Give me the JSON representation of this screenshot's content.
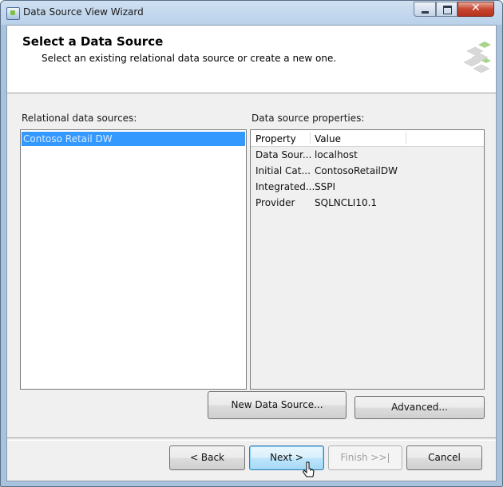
{
  "window": {
    "title": "Data Source View Wizard",
    "close_glyph": "✕"
  },
  "header": {
    "title": "Select a Data Source",
    "subtitle": "Select an existing relational data source or create a new one."
  },
  "relational": {
    "label": "Relational data sources:",
    "items": [
      "Contoso Retail DW"
    ],
    "selected_index": 0
  },
  "properties": {
    "label": "Data source properties:",
    "columns": [
      "Property",
      "Value"
    ],
    "rows": [
      {
        "property": "Data Sour...",
        "value": "localhost"
      },
      {
        "property": "Initial Cat...",
        "value": "ContosoRetailDW"
      },
      {
        "property": "Integrated...",
        "value": "SSPI"
      },
      {
        "property": "Provider",
        "value": "SQLNCLI10.1"
      }
    ]
  },
  "buttons": {
    "new_data_source": "New Data Source...",
    "advanced": "Advanced...",
    "back": "< Back",
    "next": "Next >",
    "finish": "Finish >>|",
    "cancel": "Cancel"
  },
  "colors": {
    "selection": "#3399ff",
    "close_button": "#c7452f"
  },
  "icons": [
    "app-icon",
    "minimize-icon",
    "maximize-icon",
    "close-icon",
    "wizard-graphic-icon",
    "mouse-cursor-icon"
  ]
}
